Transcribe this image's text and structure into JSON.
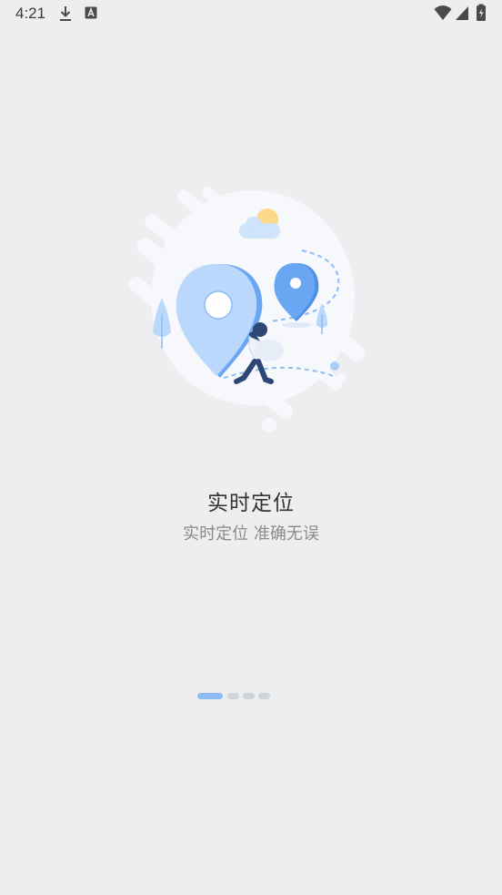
{
  "status_bar": {
    "time": "4:21",
    "left_icons": [
      "download-icon",
      "a-icon"
    ],
    "right_icons": [
      "wifi-icon",
      "signal-icon",
      "battery-charging-icon"
    ]
  },
  "onboarding": {
    "title": "实时定位",
    "subtitle": "实时定位 准确无误",
    "illustration": "location-illustration",
    "page_indicator": {
      "total": 4,
      "current": 1
    }
  },
  "colors": {
    "background": "#eeeef0",
    "accent_blue": "#6aa6f2",
    "light_blue": "#b9d8fb",
    "indicator_active": "#8dbcf5",
    "indicator_inactive": "#cfd3da",
    "title_text": "#333333",
    "subtitle_text": "#8a8a8a"
  }
}
